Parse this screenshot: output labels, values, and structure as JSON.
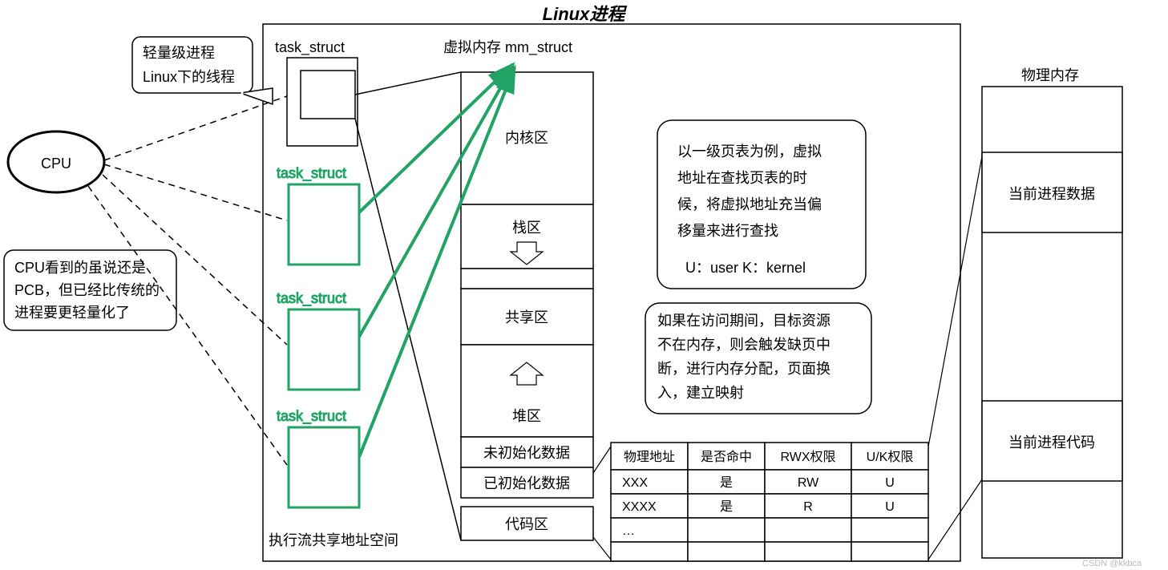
{
  "title": "Linux进程",
  "cpu": "CPU",
  "thread_bubble": {
    "line1": "轻量级进程",
    "line2": "Linux下的线程"
  },
  "cpu_note": {
    "line1": "CPU看到的虽说还是",
    "line2": "PCB，但已经比传统的",
    "line3": "进程要更轻量化了"
  },
  "task_label_top": "task_struct",
  "task_label_green": "task_struct",
  "mm_label": "虚拟内存 mm_struct",
  "mm_sections": {
    "kernel": "内核区",
    "stack": "栈区",
    "shared": "共享区",
    "heap": "堆区",
    "bss": "未初始化数据",
    "data": "已初始化数据",
    "code": "代码区"
  },
  "exec_share": "执行流共享地址空间",
  "note1": {
    "line1": "以一级页表为例，虚拟",
    "line2": "地址在查找页表的时",
    "line3": "候，将虚拟地址充当偏",
    "line4": "移量来进行查找",
    "line5": "U：user  K：kernel"
  },
  "note2": {
    "line1": "如果在访问期间，目标资源",
    "line2": "不在内存，则会触发缺页中",
    "line3": "断，进行内存分配，页面换",
    "line4": "入，建立映射"
  },
  "page_table": {
    "headers": {
      "phys": "物理地址",
      "hit": "是否命中",
      "rwx": "RWX权限",
      "uk": "U/K权限"
    },
    "rows": [
      {
        "phys": "XXX",
        "hit": "是",
        "rwx": "RW",
        "uk": "U"
      },
      {
        "phys": "XXXX",
        "hit": "是",
        "rwx": "R",
        "uk": "U"
      },
      {
        "phys": "…",
        "hit": "",
        "rwx": "",
        "uk": ""
      },
      {
        "phys": "",
        "hit": "",
        "rwx": "",
        "uk": ""
      }
    ]
  },
  "physmem": {
    "title": "物理内存",
    "data": "当前进程数据",
    "code": "当前进程代码"
  },
  "watermark": "CSDN @kkbca"
}
